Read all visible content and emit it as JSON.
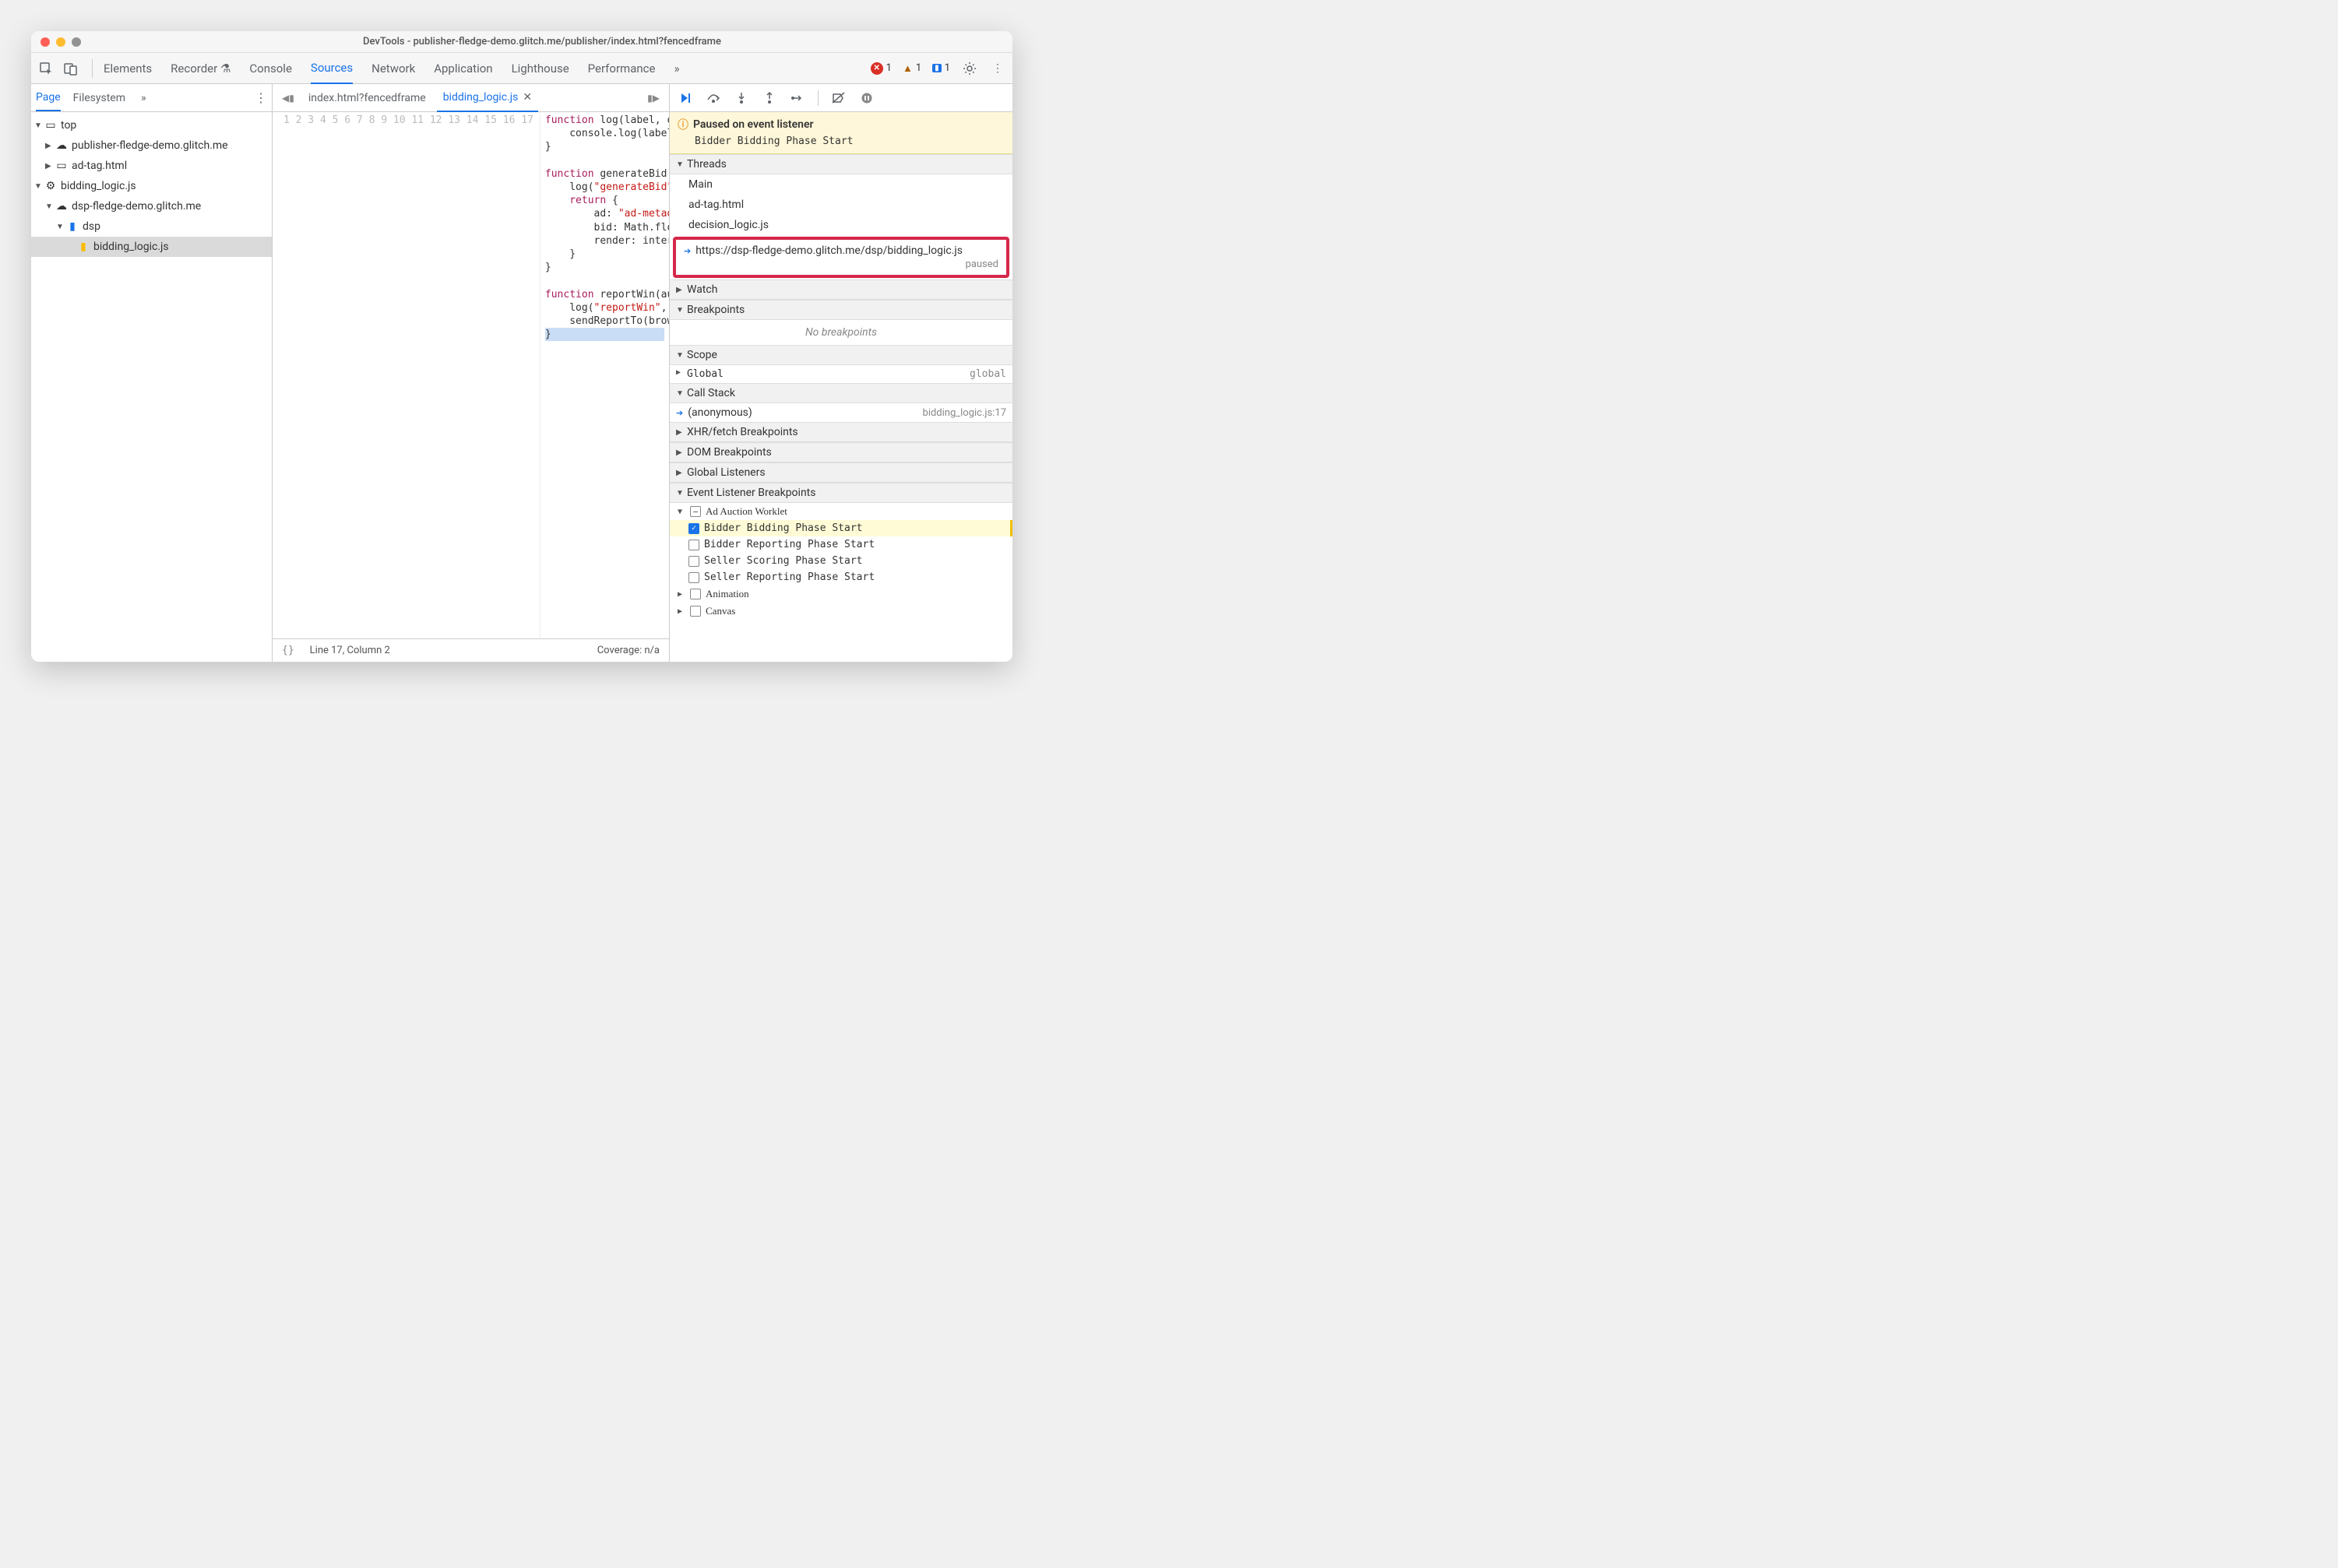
{
  "title": "DevTools - publisher-fledge-demo.glitch.me/publisher/index.html?fencedframe",
  "toolbar": {
    "tabs": [
      "Elements",
      "Recorder",
      "Console",
      "Sources",
      "Network",
      "Application",
      "Lighthouse",
      "Performance"
    ],
    "active_tab": "Sources",
    "errors": "1",
    "warnings": "1",
    "messages": "1"
  },
  "sidebar": {
    "tabs": [
      "Page",
      "Filesystem"
    ],
    "active_tab": "Page",
    "tree": {
      "top": "top",
      "pub_domain": "publisher-fledge-demo.glitch.me",
      "ad_tag": "ad-tag.html",
      "worklet": "bidding_logic.js",
      "dsp_domain": "dsp-fledge-demo.glitch.me",
      "dsp_folder": "dsp",
      "dsp_file": "bidding_logic.js"
    }
  },
  "editor": {
    "tabs": [
      {
        "label": "index.html?fencedframe",
        "active": false
      },
      {
        "label": "bidding_logic.js",
        "active": true
      }
    ],
    "lines": [
      1,
      2,
      3,
      4,
      5,
      6,
      7,
      8,
      9,
      10,
      11,
      12,
      13,
      14,
      15,
      16,
      17
    ]
  },
  "statusbar": {
    "pos": "Line 17, Column 2",
    "coverage": "Coverage: n/a"
  },
  "debugger": {
    "paused_title": "Paused on event listener",
    "paused_sub": "Bidder Bidding Phase Start",
    "sections": {
      "threads": "Threads",
      "watch": "Watch",
      "breakpoints": "Breakpoints",
      "scope": "Scope",
      "callstack": "Call Stack",
      "xhr": "XHR/fetch Breakpoints",
      "dom": "DOM Breakpoints",
      "global": "Global Listeners",
      "event": "Event Listener Breakpoints"
    },
    "threads": {
      "main": "Main",
      "adtag": "ad-tag.html",
      "decision": "decision_logic.js",
      "current": "https://dsp-fledge-demo.glitch.me/dsp/bidding_logic.js",
      "paused": "paused"
    },
    "nobp": "No breakpoints",
    "scope": {
      "global": "Global",
      "global_val": "global"
    },
    "callstack": {
      "frame": "(anonymous)",
      "loc": "bidding_logic.js:17"
    },
    "event_bp": {
      "group": "Ad Auction Worklet",
      "items": [
        "Bidder Bidding Phase Start",
        "Bidder Reporting Phase Start",
        "Seller Scoring Phase Start",
        "Seller Reporting Phase Start"
      ],
      "animation": "Animation",
      "canvas": "Canvas"
    }
  }
}
